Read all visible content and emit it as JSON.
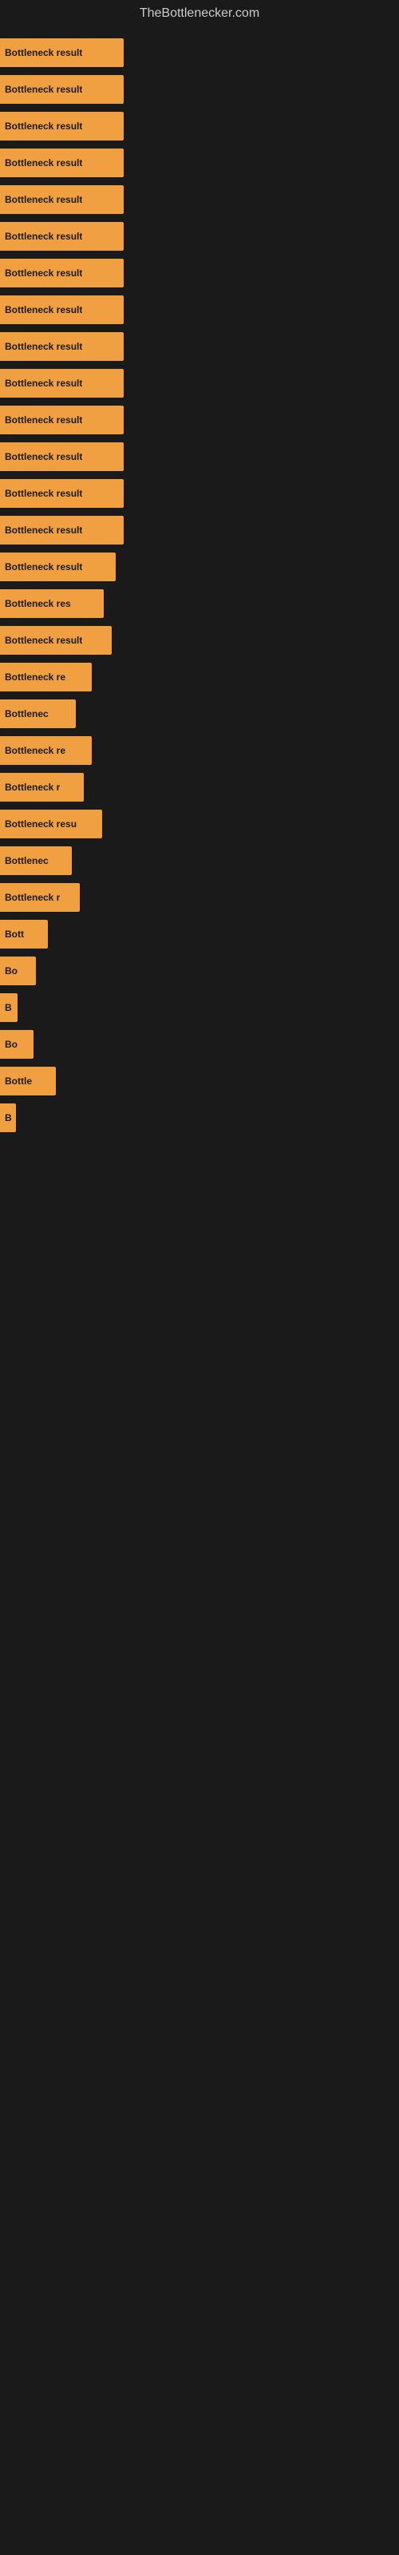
{
  "site": {
    "title": "TheBottlenecker.com"
  },
  "bars": [
    {
      "label": "Bottleneck result",
      "width": 155,
      "top_margin": 8
    },
    {
      "label": "Bottleneck result",
      "width": 155,
      "top_margin": 8
    },
    {
      "label": "Bottleneck result",
      "width": 155,
      "top_margin": 8
    },
    {
      "label": "Bottleneck result",
      "width": 155,
      "top_margin": 8
    },
    {
      "label": "Bottleneck result",
      "width": 155,
      "top_margin": 8
    },
    {
      "label": "Bottleneck result",
      "width": 155,
      "top_margin": 8
    },
    {
      "label": "Bottleneck result",
      "width": 155,
      "top_margin": 8
    },
    {
      "label": "Bottleneck result",
      "width": 155,
      "top_margin": 8
    },
    {
      "label": "Bottleneck result",
      "width": 155,
      "top_margin": 8
    },
    {
      "label": "Bottleneck result",
      "width": 155,
      "top_margin": 8
    },
    {
      "label": "Bottleneck result",
      "width": 155,
      "top_margin": 8
    },
    {
      "label": "Bottleneck result",
      "width": 155,
      "top_margin": 8
    },
    {
      "label": "Bottleneck result",
      "width": 155,
      "top_margin": 8
    },
    {
      "label": "Bottleneck result",
      "width": 155,
      "top_margin": 8
    },
    {
      "label": "Bottleneck result",
      "width": 145,
      "top_margin": 8
    },
    {
      "label": "Bottleneck res",
      "width": 130,
      "top_margin": 8
    },
    {
      "label": "Bottleneck result",
      "width": 140,
      "top_margin": 8
    },
    {
      "label": "Bottleneck re",
      "width": 115,
      "top_margin": 8
    },
    {
      "label": "Bottlenec",
      "width": 95,
      "top_margin": 8
    },
    {
      "label": "Bottleneck re",
      "width": 115,
      "top_margin": 8
    },
    {
      "label": "Bottleneck r",
      "width": 105,
      "top_margin": 8
    },
    {
      "label": "Bottleneck resu",
      "width": 128,
      "top_margin": 8
    },
    {
      "label": "Bottlenec",
      "width": 90,
      "top_margin": 8
    },
    {
      "label": "Bottleneck r",
      "width": 100,
      "top_margin": 8
    },
    {
      "label": "Bott",
      "width": 60,
      "top_margin": 8
    },
    {
      "label": "Bo",
      "width": 45,
      "top_margin": 8
    },
    {
      "label": "B",
      "width": 22,
      "top_margin": 8
    },
    {
      "label": "Bo",
      "width": 42,
      "top_margin": 8
    },
    {
      "label": "Bottle",
      "width": 70,
      "top_margin": 8
    },
    {
      "label": "B",
      "width": 18,
      "top_margin": 8
    },
    {
      "label": "",
      "width": 0,
      "top_margin": 8
    },
    {
      "label": "",
      "width": 0,
      "top_margin": 8
    },
    {
      "label": "",
      "width": 0,
      "top_margin": 8
    },
    {
      "label": "",
      "width": 0,
      "top_margin": 8
    },
    {
      "label": "",
      "width": 0,
      "top_margin": 8
    },
    {
      "label": "",
      "width": 0,
      "top_margin": 8
    },
    {
      "label": "",
      "width": 0,
      "top_margin": 8
    },
    {
      "label": "",
      "width": 0,
      "top_margin": 8
    },
    {
      "label": "",
      "width": 0,
      "top_margin": 8
    },
    {
      "label": "",
      "width": 0,
      "top_margin": 8
    },
    {
      "label": "",
      "width": 0,
      "top_margin": 8
    },
    {
      "label": "",
      "width": 0,
      "top_margin": 8
    },
    {
      "label": "",
      "width": 0,
      "top_margin": 8
    },
    {
      "label": "",
      "width": 0,
      "top_margin": 8
    },
    {
      "label": "",
      "width": 0,
      "top_margin": 8
    },
    {
      "label": "",
      "width": 0,
      "top_margin": 8
    },
    {
      "label": "",
      "width": 0,
      "top_margin": 8
    },
    {
      "label": "",
      "width": 0,
      "top_margin": 8
    },
    {
      "label": "",
      "width": 0,
      "top_margin": 8
    },
    {
      "label": "",
      "width": 0,
      "top_margin": 8
    },
    {
      "label": "",
      "width": 0,
      "top_margin": 8
    },
    {
      "label": "",
      "width": 0,
      "top_margin": 8
    },
    {
      "label": "",
      "width": 0,
      "top_margin": 8
    },
    {
      "label": "",
      "width": 0,
      "top_margin": 8
    },
    {
      "label": "",
      "width": 0,
      "top_margin": 8
    },
    {
      "label": "",
      "width": 0,
      "top_margin": 8
    },
    {
      "label": "",
      "width": 0,
      "top_margin": 8
    },
    {
      "label": "",
      "width": 0,
      "top_margin": 8
    },
    {
      "label": "",
      "width": 0,
      "top_margin": 8
    },
    {
      "label": "",
      "width": 0,
      "top_margin": 8
    },
    {
      "label": "",
      "width": 0,
      "top_margin": 8
    }
  ]
}
